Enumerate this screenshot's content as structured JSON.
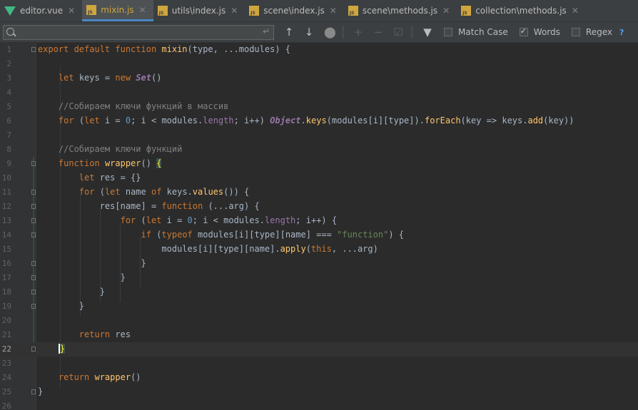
{
  "tabs": [
    {
      "label": "editor.vue",
      "icon": "vue-icon",
      "active": false
    },
    {
      "label": "mixin.js",
      "icon": "js-file-icon",
      "active": true
    },
    {
      "label": "utils\\index.js",
      "icon": "js-file-icon",
      "active": false
    },
    {
      "label": "scene\\index.js",
      "icon": "js-file-icon",
      "active": false
    },
    {
      "label": "scene\\methods.js",
      "icon": "js-file-icon",
      "active": false
    },
    {
      "label": "collection\\methods.js",
      "icon": "js-file-icon",
      "active": false
    }
  ],
  "search": {
    "value": "",
    "placeholder": "",
    "options": [
      {
        "label": "Match Case",
        "checked": false
      },
      {
        "label": "Words",
        "checked": true
      },
      {
        "label": "Regex",
        "checked": false
      }
    ],
    "help": "?"
  },
  "line_numbers": [
    "1",
    "2",
    "3",
    "4",
    "5",
    "6",
    "7",
    "8",
    "9",
    "10",
    "11",
    "12",
    "13",
    "14",
    "15",
    "16",
    "17",
    "18",
    "19",
    "20",
    "21",
    "22",
    "23",
    "24",
    "25",
    "26"
  ],
  "current_line": 22,
  "colors": {
    "keyword": "#cc7832",
    "function": "#ffc66d",
    "string": "#6a8759",
    "number": "#6897bb",
    "comment": "#808080",
    "property": "#9876aa",
    "background": "#2b2b2b",
    "accent": "#4a88c7"
  },
  "code": {
    "l1": {
      "kw1": "export default function ",
      "name": "mixin",
      "rest": "(type, ...modules) {"
    },
    "l3": {
      "kw": "let ",
      "t1": "keys = ",
      "kw2": "new ",
      "cls": "Set",
      "t2": "()"
    },
    "l5": {
      "comment": "//Собираем ключи функций в массив"
    },
    "l6": {
      "kw1": "for ",
      "t1": "(",
      "kw2": "let ",
      "t2": "i = ",
      "n0": "0",
      "t3": "; i < modules.",
      "p1": "length",
      "t4": "; i++) ",
      "cls": "Object",
      "t5": ".",
      "f1": "keys",
      "t6": "(modules[i][type]).",
      "f2": "forEach",
      "t7": "(key => keys.",
      "f3": "add",
      "t8": "(key))"
    },
    "l8": {
      "comment": "//Собираем ключи функций"
    },
    "l9": {
      "kw": "function ",
      "name": "wrapper",
      "t1": "() ",
      "brace": "{"
    },
    "l10": {
      "kw": "let ",
      "t1": "res = {}"
    },
    "l11": {
      "kw1": "for ",
      "t1": "(",
      "kw2": "let ",
      "t2": "name ",
      "kw3": "of ",
      "t3": "keys.",
      "f1": "values",
      "t4": "()) {"
    },
    "l12": {
      "t1": "res[name] = ",
      "kw": "function ",
      "t2": "(...arg) {"
    },
    "l13": {
      "kw1": "for ",
      "t1": "(",
      "kw2": "let ",
      "t2": "i = ",
      "n0": "0",
      "t3": "; i < modules.",
      "p1": "length",
      "t4": "; i++) {"
    },
    "l14": {
      "kw1": "if ",
      "t1": "(",
      "kw2": "typeof ",
      "t2": "modules[i][type][name] === ",
      "s1": "\"function\"",
      "t3": ") {"
    },
    "l15": {
      "t1": "modules[i][type][name].",
      "f1": "apply",
      "t2": "(",
      "kw": "this",
      "t3": ", ...arg)"
    },
    "l16": {
      "t1": "}"
    },
    "l17": {
      "t1": "}"
    },
    "l18": {
      "t1": "}"
    },
    "l19": {
      "t1": "}"
    },
    "l21": {
      "kw": "return ",
      "t1": "res"
    },
    "l22": {
      "brace": "}"
    },
    "l24": {
      "kw": "return ",
      "f1": "wrapper",
      "t1": "()"
    },
    "l25": {
      "t1": "}"
    }
  }
}
